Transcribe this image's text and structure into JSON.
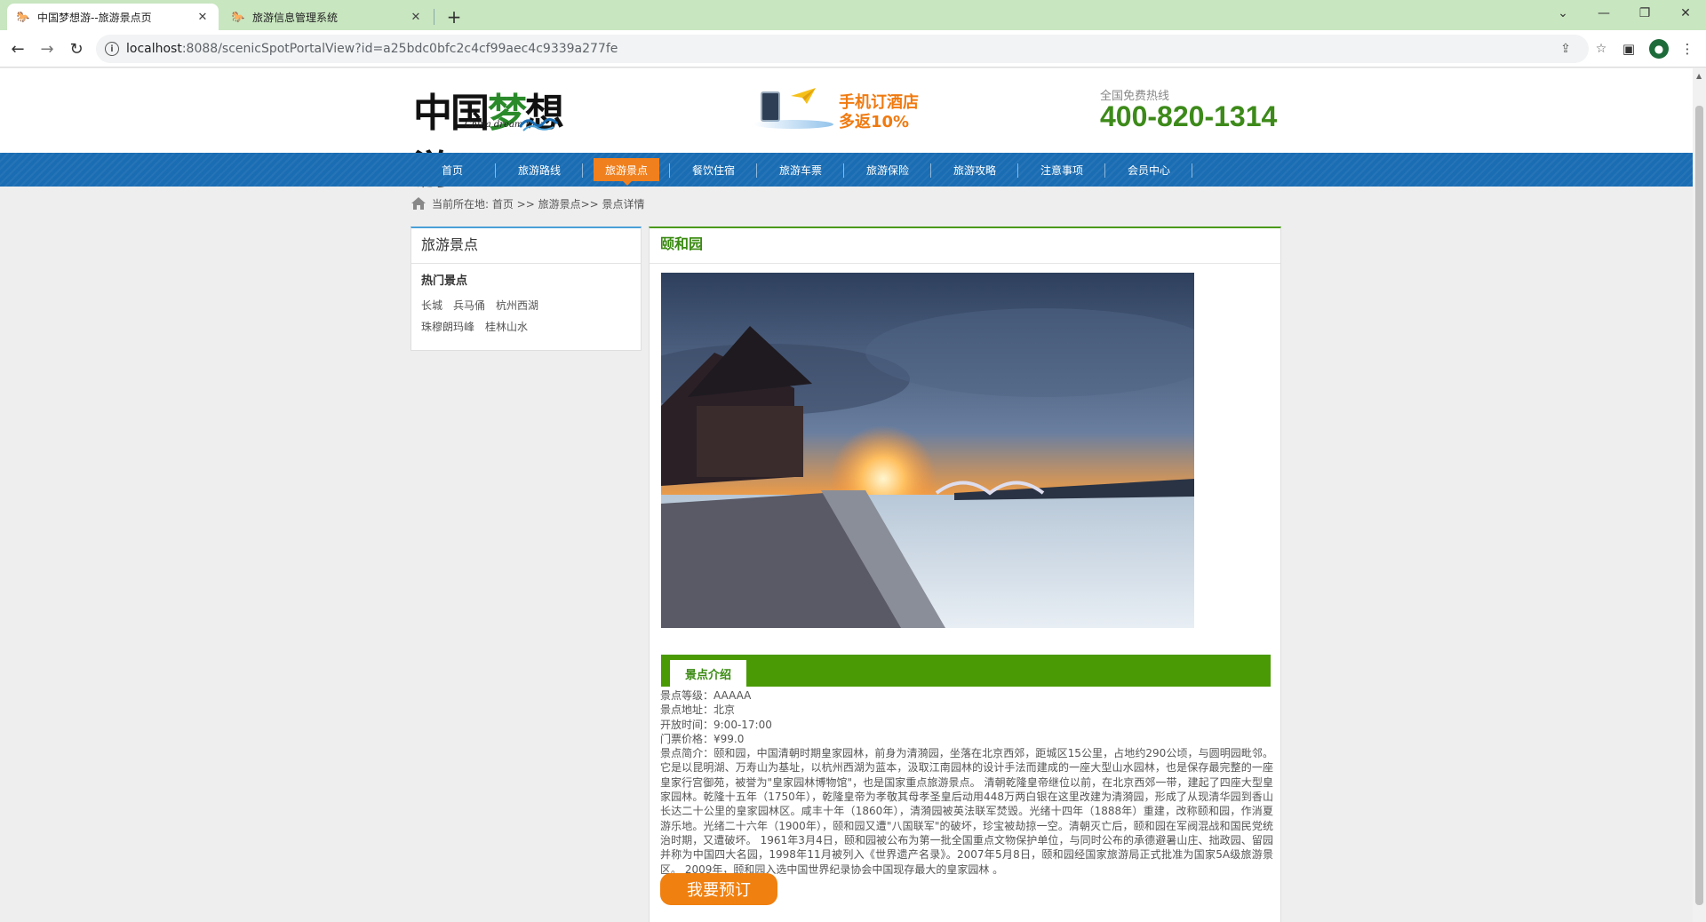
{
  "browser": {
    "tabs": [
      {
        "title": "中国梦想游--旅游景点页",
        "active": true
      },
      {
        "title": "旅游信息管理系统",
        "active": false
      }
    ],
    "url_host": "localhost",
    "url_path": ":8088/scenicSpotPortalView?id=a25bdc0bfc2c4cf99aec4c9339a277fe"
  },
  "header": {
    "logo_text": "中国梦想游",
    "logo_en": "China dream tour",
    "promo_line1": "手机订酒店",
    "promo_line2": "多返10%",
    "hotline_label": "全国免费热线",
    "hotline_number": "400-820-1314"
  },
  "nav": {
    "items": [
      "首页",
      "旅游路线",
      "旅游景点",
      "餐饮住宿",
      "旅游车票",
      "旅游保险",
      "旅游攻略",
      "注意事项",
      "会员中心"
    ],
    "active_index": 2
  },
  "breadcrumb": "当前所在地: 首页 >> 旅游景点>> 景点详情",
  "sidebar": {
    "title": "旅游景点",
    "subtitle": "热门景点",
    "links": [
      "长城",
      "兵马俑",
      "杭州西湖",
      "珠穆朗玛峰",
      "桂林山水"
    ]
  },
  "spot": {
    "name": "颐和园",
    "intro_tab": "景点介绍",
    "level": "景点等级：AAAAA",
    "address": "景点地址：北京",
    "hours": "开放时间：9:00-17:00",
    "price": "门票价格：¥99.0",
    "description": "景点简介：颐和园，中国清朝时期皇家园林，前身为清漪园，坐落在北京西郊，距城区15公里，占地约290公顷，与圆明园毗邻。它是以昆明湖、万寿山为基址，以杭州西湖为蓝本，汲取江南园林的设计手法而建成的一座大型山水园林，也是保存最完整的一座皇家行宫御苑，被誉为\"皇家园林博物馆\"，也是国家重点旅游景点。 清朝乾隆皇帝继位以前，在北京西郊一带，建起了四座大型皇家园林。乾隆十五年（1750年），乾隆皇帝为孝敬其母孝圣皇后动用448万两白银在这里改建为清漪园，形成了从现清华园到香山长达二十公里的皇家园林区。咸丰十年（1860年），清漪园被英法联军焚毁。光绪十四年（1888年）重建，改称颐和园，作消夏游乐地。光绪二十六年（1900年），颐和园又遭\"八国联军\"的破坏，珍宝被劫掠一空。清朝灭亡后，颐和园在军阀混战和国民党统治时期，又遭破坏。 1961年3月4日，颐和园被公布为第一批全国重点文物保护单位，与同时公布的承德避暑山庄、拙政园、留园并称为中国四大名园，1998年11月被列入《世界遗产名录》。2007年5月8日，颐和园经国家旅游局正式批准为国家5A级旅游景区。 2009年，颐和园入选中国世界纪录协会中国现存最大的皇家园林 。",
    "book_button": "我要预订"
  },
  "colors": {
    "nav_blue": "#1a6db3",
    "nav_active": "#f0801e",
    "green": "#4a9a05",
    "book_orange": "#f08010"
  }
}
